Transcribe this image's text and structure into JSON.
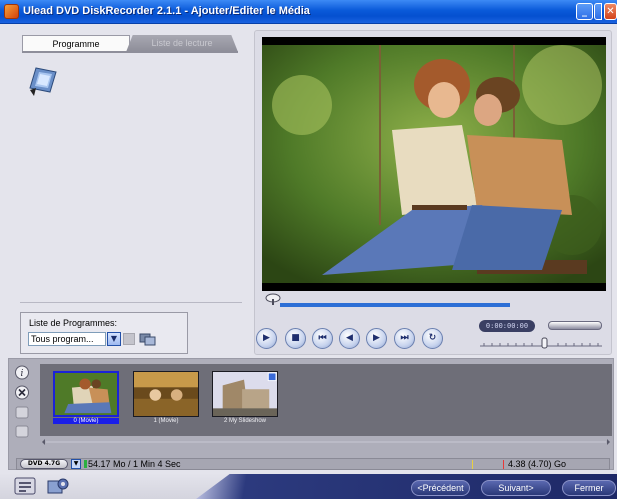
{
  "window": {
    "title": "Ulead DVD DiskRecorder 2.1.1 - Ajouter/Editer le Média",
    "min_symbol": "_",
    "max_symbol": "□",
    "close_symbol": "✕"
  },
  "tabs": [
    {
      "label": "Programme",
      "active": true
    },
    {
      "label": "Liste de lecture",
      "active": false
    }
  ],
  "program_list": {
    "label": "Liste de Programmes:",
    "selected": "Tous program..."
  },
  "playback": {
    "timecode": "0:00:00:00",
    "progress": 0.0,
    "controls": [
      {
        "name": "play-button",
        "glyph": "▶"
      },
      {
        "name": "stop-button",
        "glyph": "■"
      },
      {
        "name": "go-to-start-button",
        "glyph": "⏮"
      },
      {
        "name": "previous-frame-button",
        "glyph": "◀"
      },
      {
        "name": "next-frame-button",
        "glyph": "▶"
      },
      {
        "name": "go-to-end-button",
        "glyph": "⏭"
      },
      {
        "name": "repeat-button",
        "glyph": "↻"
      }
    ]
  },
  "storyboard": {
    "items": [
      {
        "caption": "0 (Movie)",
        "selected": true
      },
      {
        "caption": "1 (Movie)",
        "selected": false
      },
      {
        "caption": "2 My Slideshow",
        "selected": false
      }
    ]
  },
  "capacity": {
    "disc": "DVD 4.7G",
    "used": "54.17 Mo / 1 Min 4 Sec",
    "total": "4.38 (4.70) Go",
    "fill_color": "#2bb040"
  },
  "nav": {
    "previous": "<Précédent",
    "next": "Suivant>",
    "close": "Fermer"
  },
  "colors": {
    "titlebar": "#0a5ad9",
    "selection": "#1a1ee8",
    "seek_bar": "#2d6fd6"
  }
}
